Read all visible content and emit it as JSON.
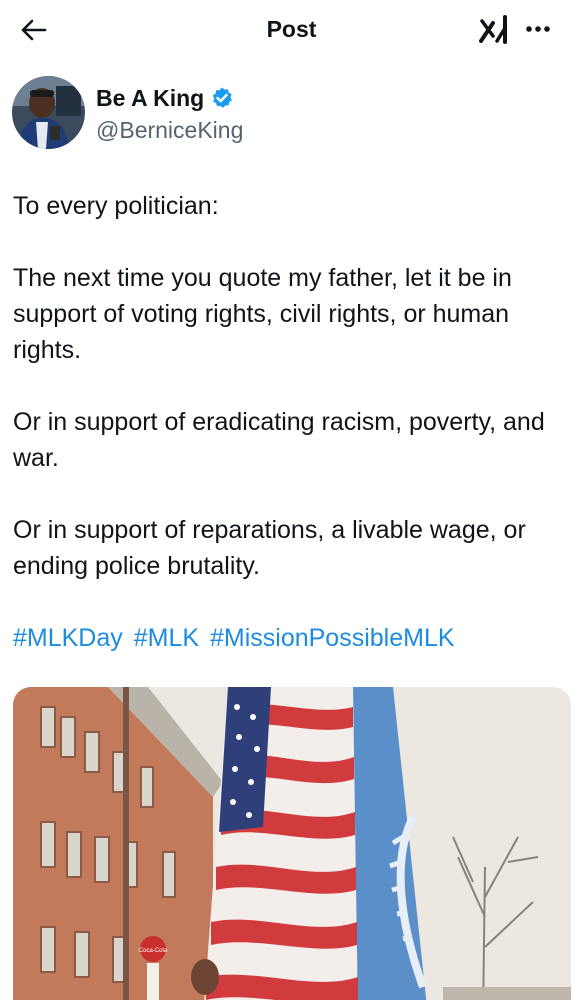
{
  "header": {
    "title": "Post",
    "back_icon": "arrow-left-icon",
    "grok_icon": "grok-icon",
    "more_icon": "more-horizontal-icon"
  },
  "author": {
    "display_name": "Be A King",
    "handle": "@BerniceKing",
    "verified_color": "#1d9bf0"
  },
  "tweet": {
    "paragraphs": [
      "To every politician:",
      "The next time you quote my father, let it be in support of voting rights, civil rights, or human rights.",
      "Or in support of eradicating racism, poverty, and war.",
      "Or in support of reparations, a livable wage, or ending police brutality."
    ],
    "hashtags": [
      "#MLKDay",
      "#MLK",
      "#MissionPossibleMLK"
    ],
    "hashtag_color": "#1d8ce0"
  },
  "media": {
    "sign_text": "Coca-Cola"
  }
}
